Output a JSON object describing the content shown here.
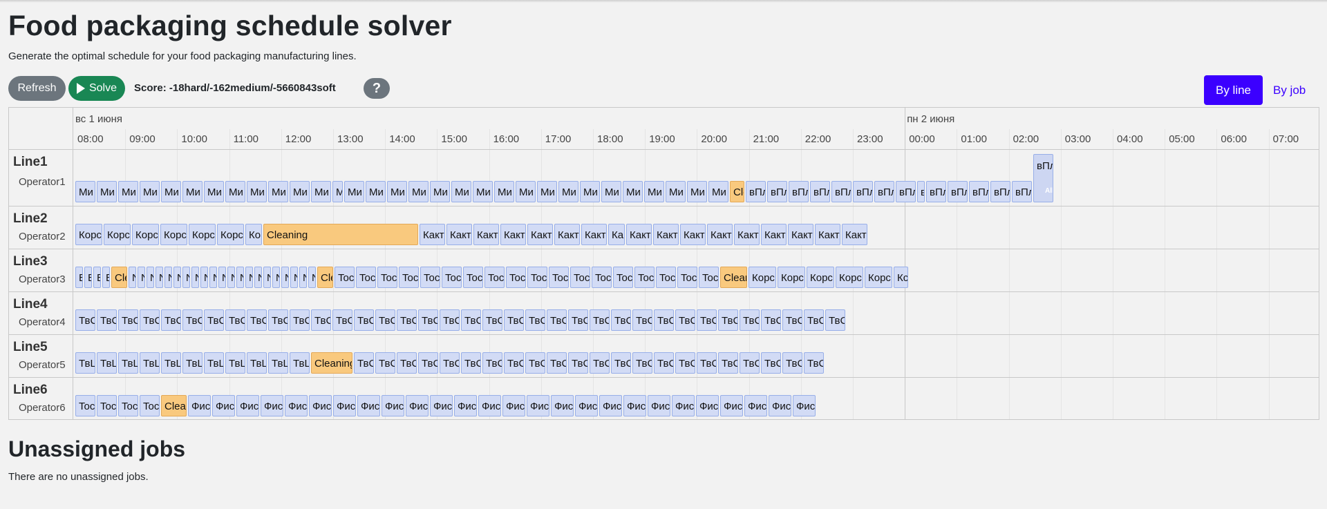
{
  "page": {
    "title": "Food packaging schedule solver",
    "subtitle": "Generate the optimal schedule for your food packaging manufacturing lines."
  },
  "toolbar": {
    "refresh_label": "Refresh",
    "solve_label": "Solve",
    "score": "Score: -18hard/-162medium/-5660843soft",
    "help_label": "?",
    "view_by_line": "By line",
    "view_by_job": "By job"
  },
  "colors": {
    "accent": "#3b00ff",
    "job_fill": "#d2dbf5",
    "cleaning_fill": "#f9c97e",
    "solve_green": "#198754",
    "refresh_gray": "#6c757d"
  },
  "timeline": {
    "day_labels": [
      "вс 1 июня",
      "пн 2 июня"
    ],
    "hours": [
      "08:00",
      "09:00",
      "10:00",
      "11:00",
      "12:00",
      "13:00",
      "14:00",
      "15:00",
      "16:00",
      "17:00",
      "18:00",
      "19:00",
      "20:00",
      "21:00",
      "22:00",
      "23:00",
      "00:00",
      "01:00",
      "02:00",
      "03:00",
      "04:00",
      "05:00",
      "06:00",
      "07:00"
    ],
    "lines": [
      {
        "name": "Line1",
        "operator": "Operator1",
        "jobs": [
          {
            "w": 30,
            "t": "Ми"
          },
          {
            "w": 30,
            "t": "Ми"
          },
          {
            "w": 30,
            "t": "Ми"
          },
          {
            "w": 30,
            "t": "Ми"
          },
          {
            "w": 30,
            "t": "Ми"
          },
          {
            "w": 30,
            "t": "Ми"
          },
          {
            "w": 30,
            "t": "Ми"
          },
          {
            "w": 30,
            "t": "Ми"
          },
          {
            "w": 30,
            "t": "Ми"
          },
          {
            "w": 30,
            "t": "Ми"
          },
          {
            "w": 30,
            "t": "Ми"
          },
          {
            "w": 30,
            "t": "Ми"
          },
          {
            "w": 16,
            "t": "М"
          },
          {
            "w": 30,
            "t": "Ми"
          },
          {
            "w": 30,
            "t": "Ми"
          },
          {
            "w": 30,
            "t": "Ми"
          },
          {
            "w": 30,
            "t": "Ми"
          },
          {
            "w": 30,
            "t": "Ми"
          },
          {
            "w": 30,
            "t": "Ми"
          },
          {
            "w": 30,
            "t": "Ми"
          },
          {
            "w": 30,
            "t": "Ми"
          },
          {
            "w": 30,
            "t": "Ми"
          },
          {
            "w": 30,
            "t": "Ми"
          },
          {
            "w": 30,
            "t": "Ми"
          },
          {
            "w": 30,
            "t": "Ми"
          },
          {
            "w": 30,
            "t": "Ми"
          },
          {
            "w": 30,
            "t": "Ми"
          },
          {
            "w": 30,
            "t": "Ми"
          },
          {
            "w": 30,
            "t": "Ми"
          },
          {
            "w": 30,
            "t": "Ми"
          },
          {
            "w": 30,
            "t": "Ми"
          },
          {
            "w": 22,
            "t": "Cle",
            "c": true
          },
          {
            "w": 30,
            "t": "вПл"
          },
          {
            "w": 30,
            "t": "вПл"
          },
          {
            "w": 30,
            "t": "вПл"
          },
          {
            "w": 30,
            "t": "вПл"
          },
          {
            "w": 30,
            "t": "вПл"
          },
          {
            "w": 30,
            "t": "вПл"
          },
          {
            "w": 30,
            "t": "вПл"
          },
          {
            "w": 30,
            "t": "вПл"
          },
          {
            "w": 12,
            "t": "в"
          },
          {
            "w": 30,
            "t": "вПл"
          },
          {
            "w": 30,
            "t": "вПл"
          },
          {
            "w": 30,
            "t": "вПл"
          },
          {
            "w": 30,
            "t": "вПл"
          },
          {
            "w": 30,
            "t": "вПл"
          },
          {
            "w": 30,
            "t": "вПл",
            "tall": true,
            "sub": "All"
          }
        ]
      },
      {
        "name": "Line2",
        "operator": "Operator2",
        "jobs": [
          {
            "w": 40,
            "t": "Корс"
          },
          {
            "w": 40,
            "t": "Корс"
          },
          {
            "w": 40,
            "t": "Корс"
          },
          {
            "w": 40,
            "t": "Корс"
          },
          {
            "w": 40,
            "t": "Корс"
          },
          {
            "w": 40,
            "t": "Корс"
          },
          {
            "w": 25,
            "t": "Ко"
          },
          {
            "w": 225,
            "t": "Cleaning",
            "c": true
          },
          {
            "w": 38,
            "t": "Какт"
          },
          {
            "w": 38,
            "t": "Какт"
          },
          {
            "w": 38,
            "t": "Какт"
          },
          {
            "w": 38,
            "t": "Какт"
          },
          {
            "w": 38,
            "t": "Какт"
          },
          {
            "w": 38,
            "t": "Какт"
          },
          {
            "w": 38,
            "t": "Какт"
          },
          {
            "w": 25,
            "t": "Ка"
          },
          {
            "w": 38,
            "t": "Какт"
          },
          {
            "w": 38,
            "t": "Какт"
          },
          {
            "w": 38,
            "t": "Какт"
          },
          {
            "w": 38,
            "t": "Какт"
          },
          {
            "w": 38,
            "t": "Какт"
          },
          {
            "w": 38,
            "t": "Какт"
          },
          {
            "w": 38,
            "t": "Какт"
          },
          {
            "w": 38,
            "t": "Какт"
          },
          {
            "w": 38,
            "t": "Какт"
          }
        ]
      },
      {
        "name": "Line3",
        "operator": "Operator3",
        "jobs": [
          {
            "w": 12,
            "t": "В"
          },
          {
            "w": 12,
            "t": "В"
          },
          {
            "w": 12,
            "t": "В"
          },
          {
            "w": 12,
            "t": "В"
          },
          {
            "w": 24,
            "t": "Cle",
            "c": true
          },
          {
            "w": 12,
            "t": "N"
          },
          {
            "w": 12,
            "t": "N"
          },
          {
            "w": 12,
            "t": "N"
          },
          {
            "w": 12,
            "t": "N"
          },
          {
            "w": 12,
            "t": "N"
          },
          {
            "w": 12,
            "t": "N"
          },
          {
            "w": 12,
            "t": "N"
          },
          {
            "w": 12,
            "t": "N"
          },
          {
            "w": 12,
            "t": "N"
          },
          {
            "w": 12,
            "t": "N"
          },
          {
            "w": 12,
            "t": "N"
          },
          {
            "w": 12,
            "t": "N"
          },
          {
            "w": 12,
            "t": "N"
          },
          {
            "w": 12,
            "t": "N"
          },
          {
            "w": 12,
            "t": "N"
          },
          {
            "w": 12,
            "t": "N"
          },
          {
            "w": 12,
            "t": "N"
          },
          {
            "w": 12,
            "t": "N"
          },
          {
            "w": 12,
            "t": "N"
          },
          {
            "w": 12,
            "t": "N"
          },
          {
            "w": 12,
            "t": "N"
          },
          {
            "w": 24,
            "t": "Cle",
            "c": true
          },
          {
            "w": 30,
            "t": "Toc"
          },
          {
            "w": 30,
            "t": "Toc"
          },
          {
            "w": 30,
            "t": "Toc"
          },
          {
            "w": 30,
            "t": "Toc"
          },
          {
            "w": 30,
            "t": "Toc"
          },
          {
            "w": 30,
            "t": "Toc"
          },
          {
            "w": 30,
            "t": "Toc"
          },
          {
            "w": 30,
            "t": "Toc"
          },
          {
            "w": 30,
            "t": "Toc"
          },
          {
            "w": 30,
            "t": "Toc"
          },
          {
            "w": 30,
            "t": "Toc"
          },
          {
            "w": 30,
            "t": "Toc"
          },
          {
            "w": 30,
            "t": "Toc"
          },
          {
            "w": 30,
            "t": "Toc"
          },
          {
            "w": 30,
            "t": "Toc"
          },
          {
            "w": 30,
            "t": "Toc"
          },
          {
            "w": 30,
            "t": "Toc"
          },
          {
            "w": 30,
            "t": "Toc"
          },
          {
            "w": 40,
            "t": "Clear",
            "c": true
          },
          {
            "w": 41,
            "t": "Корс"
          },
          {
            "w": 41,
            "t": "Корс"
          },
          {
            "w": 41,
            "t": "Корс"
          },
          {
            "w": 41,
            "t": "Корс"
          },
          {
            "w": 41,
            "t": "Корс"
          },
          {
            "w": 22,
            "t": "Кс"
          }
        ]
      },
      {
        "name": "Line4",
        "operator": "Operator4",
        "jobs": [
          {
            "w": 30,
            "t": "ТвС"
          },
          {
            "w": 30,
            "t": "ТвС"
          },
          {
            "w": 30,
            "t": "ТвС"
          },
          {
            "w": 30,
            "t": "ТвС"
          },
          {
            "w": 30,
            "t": "ТвС"
          },
          {
            "w": 30,
            "t": "ТвС"
          },
          {
            "w": 30,
            "t": "ТвС"
          },
          {
            "w": 30,
            "t": "ТвС"
          },
          {
            "w": 30,
            "t": "ТвС"
          },
          {
            "w": 30,
            "t": "ТвС"
          },
          {
            "w": 30,
            "t": "ТвС"
          },
          {
            "w": 30,
            "t": "ТвС"
          },
          {
            "w": 30,
            "t": "ТвС"
          },
          {
            "w": 30,
            "t": "ТвС"
          },
          {
            "w": 30,
            "t": "ТвС"
          },
          {
            "w": 30,
            "t": "ТвС"
          },
          {
            "w": 30,
            "t": "ТвС"
          },
          {
            "w": 30,
            "t": "ТвС"
          },
          {
            "w": 30,
            "t": "ТвС"
          },
          {
            "w": 30,
            "t": "ТвС"
          },
          {
            "w": 30,
            "t": "ТвС"
          },
          {
            "w": 30,
            "t": "ТвС"
          },
          {
            "w": 30,
            "t": "ТвС"
          },
          {
            "w": 30,
            "t": "ТвС"
          },
          {
            "w": 30,
            "t": "ТвС"
          },
          {
            "w": 30,
            "t": "ТвС"
          },
          {
            "w": 30,
            "t": "ТвС"
          },
          {
            "w": 30,
            "t": "ТвС"
          },
          {
            "w": 30,
            "t": "ТвС"
          },
          {
            "w": 30,
            "t": "ТвС"
          },
          {
            "w": 30,
            "t": "ТвС"
          },
          {
            "w": 30,
            "t": "ТвС"
          },
          {
            "w": 30,
            "t": "ТвС"
          },
          {
            "w": 30,
            "t": "ТвС"
          },
          {
            "w": 30,
            "t": "ТвС"
          },
          {
            "w": 30,
            "t": "ТвС"
          }
        ]
      },
      {
        "name": "Line5",
        "operator": "Operator5",
        "jobs": [
          {
            "w": 30,
            "t": "ТвL"
          },
          {
            "w": 30,
            "t": "ТвL"
          },
          {
            "w": 30,
            "t": "ТвL"
          },
          {
            "w": 30,
            "t": "ТвL"
          },
          {
            "w": 30,
            "t": "ТвL"
          },
          {
            "w": 30,
            "t": "ТвL"
          },
          {
            "w": 30,
            "t": "ТвL"
          },
          {
            "w": 30,
            "t": "ТвL"
          },
          {
            "w": 30,
            "t": "ТвL"
          },
          {
            "w": 30,
            "t": "ТвL"
          },
          {
            "w": 30,
            "t": "ТвL"
          },
          {
            "w": 61,
            "t": "Cleaning",
            "c": true
          },
          {
            "w": 30,
            "t": "ТвС"
          },
          {
            "w": 30,
            "t": "ТвС"
          },
          {
            "w": 30,
            "t": "ТвС"
          },
          {
            "w": 30,
            "t": "ТвС"
          },
          {
            "w": 30,
            "t": "ТвС"
          },
          {
            "w": 30,
            "t": "ТвС"
          },
          {
            "w": 30,
            "t": "ТвС"
          },
          {
            "w": 30,
            "t": "ТвС"
          },
          {
            "w": 30,
            "t": "ТвС"
          },
          {
            "w": 30,
            "t": "ТвС"
          },
          {
            "w": 30,
            "t": "ТвС"
          },
          {
            "w": 30,
            "t": "ТвС"
          },
          {
            "w": 30,
            "t": "ТвС"
          },
          {
            "w": 30,
            "t": "ТвС"
          },
          {
            "w": 30,
            "t": "ТвС"
          },
          {
            "w": 30,
            "t": "ТвС"
          },
          {
            "w": 30,
            "t": "ТвС"
          },
          {
            "w": 30,
            "t": "ТвС"
          },
          {
            "w": 30,
            "t": "ТвС"
          },
          {
            "w": 30,
            "t": "ТвС"
          },
          {
            "w": 30,
            "t": "ТвС"
          },
          {
            "w": 30,
            "t": "ТвС"
          }
        ]
      },
      {
        "name": "Line6",
        "operator": "Operator6",
        "jobs": [
          {
            "w": 30,
            "t": "Toc"
          },
          {
            "w": 30,
            "t": "Toc"
          },
          {
            "w": 30,
            "t": "Toc"
          },
          {
            "w": 30,
            "t": "Toc"
          },
          {
            "w": 38,
            "t": "Clean",
            "c": true
          },
          {
            "w": 34,
            "t": "Фис"
          },
          {
            "w": 34,
            "t": "Фис"
          },
          {
            "w": 34,
            "t": "Фис"
          },
          {
            "w": 34,
            "t": "Фис"
          },
          {
            "w": 34,
            "t": "Фис"
          },
          {
            "w": 34,
            "t": "Фис"
          },
          {
            "w": 34,
            "t": "Фис"
          },
          {
            "w": 34,
            "t": "Фис"
          },
          {
            "w": 34,
            "t": "Фис"
          },
          {
            "w": 34,
            "t": "Фис"
          },
          {
            "w": 34,
            "t": "Фис"
          },
          {
            "w": 34,
            "t": "Фис"
          },
          {
            "w": 34,
            "t": "Фис"
          },
          {
            "w": 34,
            "t": "Фис"
          },
          {
            "w": 34,
            "t": "Фис"
          },
          {
            "w": 34,
            "t": "Фис"
          },
          {
            "w": 34,
            "t": "Фис"
          },
          {
            "w": 34,
            "t": "Фис"
          },
          {
            "w": 34,
            "t": "Фис"
          },
          {
            "w": 34,
            "t": "Фис"
          },
          {
            "w": 34,
            "t": "Фис"
          },
          {
            "w": 34,
            "t": "Фис"
          },
          {
            "w": 34,
            "t": "Фис"
          },
          {
            "w": 34,
            "t": "Фис"
          },
          {
            "w": 34,
            "t": "Фис"
          },
          {
            "w": 34,
            "t": "Фис"
          }
        ]
      }
    ]
  },
  "unassigned": {
    "title": "Unassigned jobs",
    "message": "There are no unassigned jobs."
  }
}
